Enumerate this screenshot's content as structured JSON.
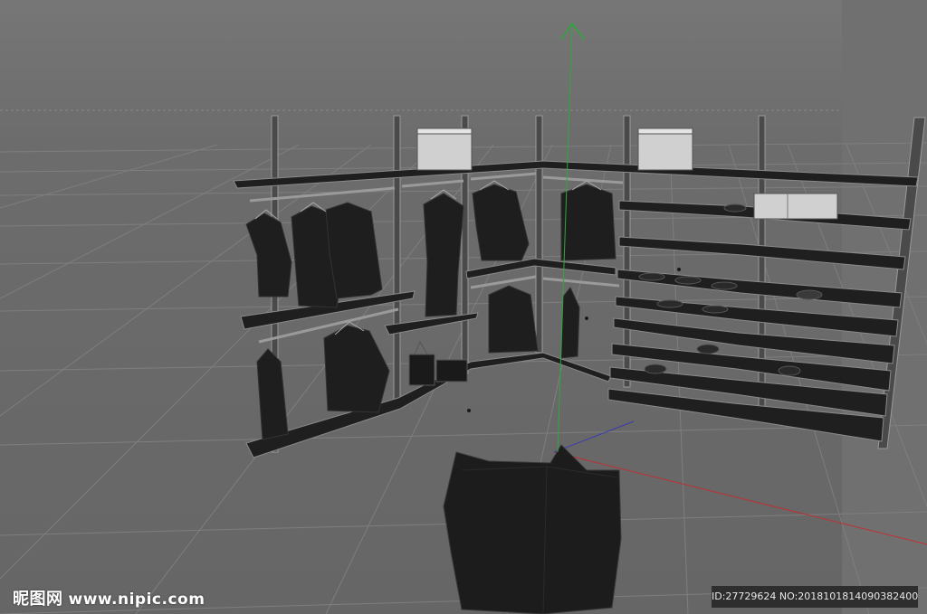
{
  "viewport": {
    "background": "#6a6a6a",
    "grid_color": "#7e7e7e",
    "axis_colors": {
      "x": "#c03030",
      "y": "#2fa83a",
      "z": "#3a3ab0"
    },
    "objects": [
      "floor-grid",
      "shelving-unit",
      "hanging-clothes",
      "storage-boxes",
      "shoe-racks",
      "laundry-bag",
      "transform-gizmo"
    ]
  },
  "watermark": {
    "site_name_cn": "昵图网",
    "site_url": "www.nipic.com",
    "image_id": "ID:27729624 NO:20181018140903824000"
  }
}
